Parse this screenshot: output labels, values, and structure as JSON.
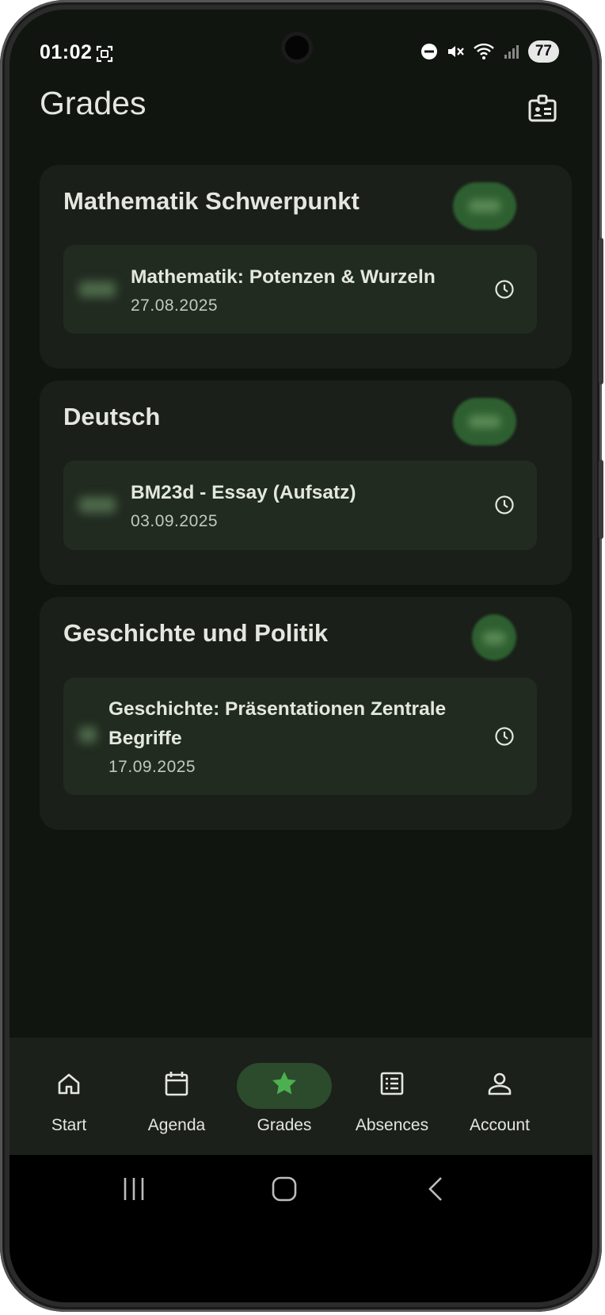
{
  "status_bar": {
    "time": "01:02",
    "battery": "77"
  },
  "header": {
    "title": "Grades"
  },
  "subjects": [
    {
      "name": "Mathematik Schwerpunkt",
      "exams": [
        {
          "name": "Mathematik: Potenzen & Wurzeln",
          "date": "27.08.2025"
        }
      ]
    },
    {
      "name": "Deutsch",
      "exams": [
        {
          "name": "BM23d - Essay (Aufsatz)",
          "date": "03.09.2025"
        }
      ]
    },
    {
      "name": "Geschichte und Politik",
      "exams": [
        {
          "name_line1": "Geschichte: Präsentationen Zentrale",
          "name_line2": "Begriffe",
          "date": "17.09.2025"
        }
      ]
    }
  ],
  "bottom_nav": {
    "items": [
      {
        "label": "Start",
        "icon": "home-icon"
      },
      {
        "label": "Agenda",
        "icon": "calendar-icon"
      },
      {
        "label": "Grades",
        "icon": "star-icon",
        "active": true
      },
      {
        "label": "Absences",
        "icon": "list-icon"
      },
      {
        "label": "Account",
        "icon": "person-icon"
      }
    ]
  },
  "colors": {
    "background": "#101510",
    "card": "#1a1f19",
    "exam_card": "#212b20",
    "accent": "#4caf50",
    "active_indicator": "#2c4a2c",
    "text": "#e3e7df"
  }
}
